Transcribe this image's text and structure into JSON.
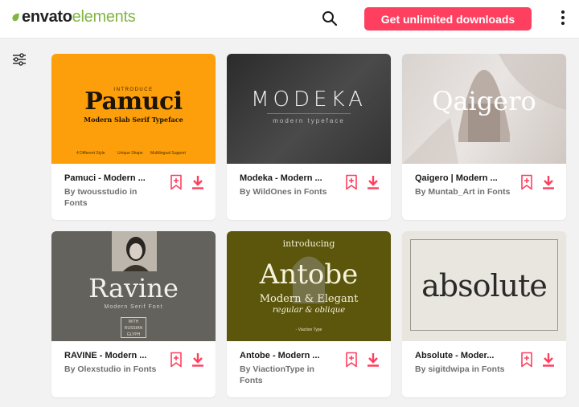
{
  "header": {
    "logo_part1": "envato",
    "logo_part2": "elements",
    "cta_label": "Get unlimited downloads",
    "brand_color": "#82b541",
    "accent_color": "#ff3f5f"
  },
  "icons": {
    "search": "search-icon",
    "menu": "kebab-menu-icon",
    "filter": "filter-sliders-icon",
    "bookmark": "bookmark-add-icon",
    "download": "download-icon"
  },
  "cards": [
    {
      "title": "Pamuci - Modern ...",
      "meta": "By twousstudio in Fonts",
      "thumb": {
        "top": "INTRODUCE",
        "main": "Pamuci",
        "sub": "Modern Slab Serif Typeface",
        "foot1": "4 Different Style",
        "foot2": "Unique Shape",
        "foot3": "Multilingual Support"
      }
    },
    {
      "title": "Modeka - Modern ...",
      "meta": "By WildOnes in Fonts",
      "thumb": {
        "main": "MODEKA",
        "sub": "modern typeface"
      }
    },
    {
      "title": "Qaigero | Modern ...",
      "meta": "By Muntab_Art in Fonts",
      "thumb": {
        "main": "Qaigero"
      }
    },
    {
      "title": "RAVINE - Modern ...",
      "meta": "By Olexstudio in Fonts",
      "thumb": {
        "main": "Ravine",
        "sub": "Modern Serif Font",
        "badge1": "WITH",
        "badge2": "RUSSIAN",
        "badge3": "GLYPH"
      }
    },
    {
      "title": "Antobe - Modern ...",
      "meta": "By ViactionType in Fonts",
      "thumb": {
        "top": "introducing",
        "main": "Antobe",
        "line2": "Modern & Elegant",
        "line3": "regular & oblique",
        "foot": "- Viaction Type"
      }
    },
    {
      "title": "Absolute - Moder...",
      "meta": "By sigitdwipa in Fonts",
      "thumb": {
        "main": "absolute"
      }
    }
  ]
}
